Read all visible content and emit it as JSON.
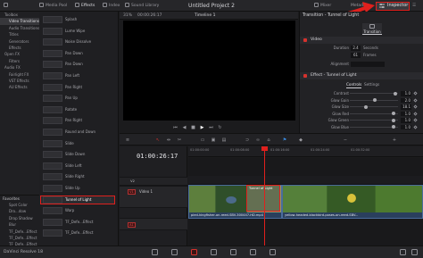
{
  "topbar": {
    "media_pool": "Media Pool",
    "effects": "Effects",
    "index": "Index",
    "sound_library": "Sound Library",
    "project_title": "Untitled Project 2",
    "mixer": "Mixer",
    "metadata": "Metadata",
    "inspector": "Inspector"
  },
  "viewer": {
    "zoom": "31%",
    "timecode": "00:00:26:17",
    "timeline_name": "Timeline 1"
  },
  "effects_tree": [
    {
      "label": "Toolbox",
      "level": 0
    },
    {
      "label": "Video Transitions",
      "level": 1,
      "selected": true
    },
    {
      "label": "Audio Transitions",
      "level": 1
    },
    {
      "label": "Titles",
      "level": 1
    },
    {
      "label": "Generators",
      "level": 1
    },
    {
      "label": "Effects",
      "level": 1
    },
    {
      "label": "Open FX",
      "level": 0
    },
    {
      "label": "Filters",
      "level": 1
    },
    {
      "label": "Audio FX",
      "level": 0
    },
    {
      "label": "Fairlight FX",
      "level": 1
    },
    {
      "label": "VST Effects",
      "level": 1
    },
    {
      "label": "AU Effects",
      "level": 1
    }
  ],
  "favorites": {
    "header": "Favorites",
    "items": [
      "Spot Color",
      "Dro...dow",
      "Drop Shadow",
      "Blur",
      "TF_Defe...Effect",
      "TF_Defe...Effect",
      "TF_Defe...Effect"
    ]
  },
  "effects_list": [
    {
      "label": "Splash"
    },
    {
      "label": "Lume Wipe"
    },
    {
      "label": "Noise Dissolve"
    },
    {
      "label": "Pan Down"
    },
    {
      "label": "Pan Down"
    },
    {
      "label": "Pan Left"
    },
    {
      "label": "Pan Right"
    },
    {
      "label": "Pan Up"
    },
    {
      "label": "Rotate"
    },
    {
      "label": "Pan Right"
    },
    {
      "label": "Round and Down"
    },
    {
      "label": "Slide"
    },
    {
      "label": "Slide Down"
    },
    {
      "label": "Slide Left"
    },
    {
      "label": "Slide Right"
    },
    {
      "label": "Slide Up"
    },
    {
      "label": "Tunnel of Light",
      "selected": true
    },
    {
      "label": "Warp"
    },
    {
      "label": "TF_Defe...Effect"
    },
    {
      "label": "TF_Defe...Effect"
    }
  ],
  "inspector": {
    "title": "Transition - Tunnel of Light",
    "tab_transition": "Transition",
    "video_section": "Video",
    "duration_label": "Duration",
    "duration_value": "2.4",
    "duration_unit": "Seconds",
    "frames_value": "61",
    "frames_unit": "Frames",
    "alignment_label": "Alignment",
    "effect_section": "Effect - Tunnel of Light",
    "controls_tab": "Controls",
    "settings_tab": "Settings",
    "params": [
      {
        "label": "Contrast",
        "value": "1.0",
        "level": 0.95
      },
      {
        "label": "Glow Gain",
        "value": "2.0",
        "level": 0.5
      },
      {
        "label": "Glow Size",
        "value": "18.1",
        "level": 0.3
      },
      {
        "label": "Glow Red",
        "value": "1.0",
        "level": 0.9
      },
      {
        "label": "Glow Green",
        "value": "1.0",
        "level": 0.9
      },
      {
        "label": "Glow Blue",
        "value": "1.0",
        "level": 0.9
      }
    ]
  },
  "timeline": {
    "timecode": "01:00:26:17",
    "ruler": [
      "01:00:00:00",
      "01:00:08:00",
      "01:00:16:00",
      "01:00:24:00",
      "01:00:32:00"
    ],
    "tracks": [
      {
        "tag": "V2",
        "name": ""
      },
      {
        "tag": "V1",
        "name": "Video 1"
      },
      {
        "tag": "A1",
        "name": ""
      }
    ],
    "clips": [
      {
        "name": "pied-kingfisher-on-reed-SBV-300447-HD.mp4"
      },
      {
        "name": "yellow-headed-blackbird-poses-on-reed-SBV..."
      }
    ],
    "transition_label": "Tunnel of Light"
  },
  "status": {
    "app_name": "DaVinci Resolve 18"
  },
  "colors": {
    "accent": "#e0201d",
    "clip": "#2a3f5d",
    "background": "#1b1b1d"
  }
}
